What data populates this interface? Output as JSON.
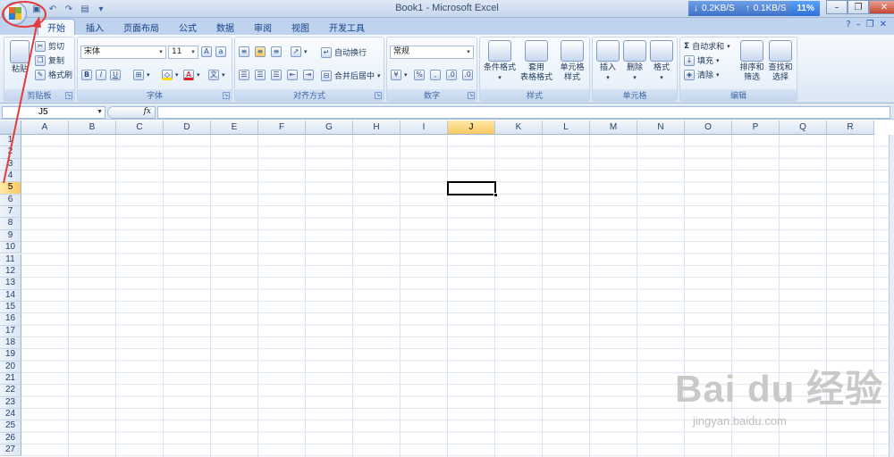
{
  "window": {
    "title": "Book1 - Microsoft Excel",
    "network": {
      "down": "0.2KB/S",
      "up": "0.1KB/S",
      "pct": "11%"
    }
  },
  "tabs": [
    {
      "label": "开始",
      "active": true
    },
    {
      "label": "插入"
    },
    {
      "label": "页面布局"
    },
    {
      "label": "公式"
    },
    {
      "label": "数据"
    },
    {
      "label": "审阅"
    },
    {
      "label": "视图"
    },
    {
      "label": "开发工具"
    }
  ],
  "ribbon": {
    "clipboard": {
      "label": "剪贴板",
      "paste": "粘贴",
      "cut": "剪切",
      "copy": "复制",
      "format_painter": "格式刷"
    },
    "font": {
      "label": "字体",
      "family": "宋体",
      "size": "11",
      "bold": "B",
      "italic": "I",
      "underline": "U"
    },
    "alignment": {
      "label": "对齐方式",
      "wrap": "自动换行",
      "merge": "合并后居中"
    },
    "number": {
      "label": "数字",
      "format": "常规"
    },
    "styles": {
      "label": "样式",
      "conditional": [
        "条件格式"
      ],
      "table": [
        "套用",
        "表格格式"
      ],
      "cell": [
        "单元格",
        "样式"
      ]
    },
    "cells": {
      "label": "单元格",
      "insert": "插入",
      "delete": "删除",
      "format": "格式"
    },
    "editing": {
      "label": "编辑",
      "autosum": "自动求和",
      "fill": "填充",
      "clear": "清除",
      "sort": [
        "排序和",
        "筛选"
      ],
      "find": [
        "查找和",
        "选择"
      ]
    }
  },
  "formula_bar": {
    "name_box": "J5",
    "fx": "fx",
    "content": ""
  },
  "sheet": {
    "columns": [
      "A",
      "B",
      "C",
      "D",
      "E",
      "F",
      "G",
      "H",
      "I",
      "J",
      "K",
      "L",
      "M",
      "N",
      "O",
      "P",
      "Q",
      "R"
    ],
    "rows": [
      "1",
      "2",
      "3",
      "4",
      "5",
      "6",
      "7",
      "8",
      "9",
      "10",
      "11",
      "12",
      "13",
      "14",
      "15",
      "16",
      "17",
      "18",
      "19",
      "20",
      "21",
      "22",
      "23",
      "24",
      "25",
      "26",
      "27"
    ],
    "selected_col": "J",
    "selected_row": "5"
  },
  "watermark": {
    "brand": "Bai  du 经验",
    "url": "jingyan.baidu.com"
  },
  "colors": {
    "accent": "#15428b",
    "annotation": "#e53b3b",
    "selection": "#f9c962"
  }
}
